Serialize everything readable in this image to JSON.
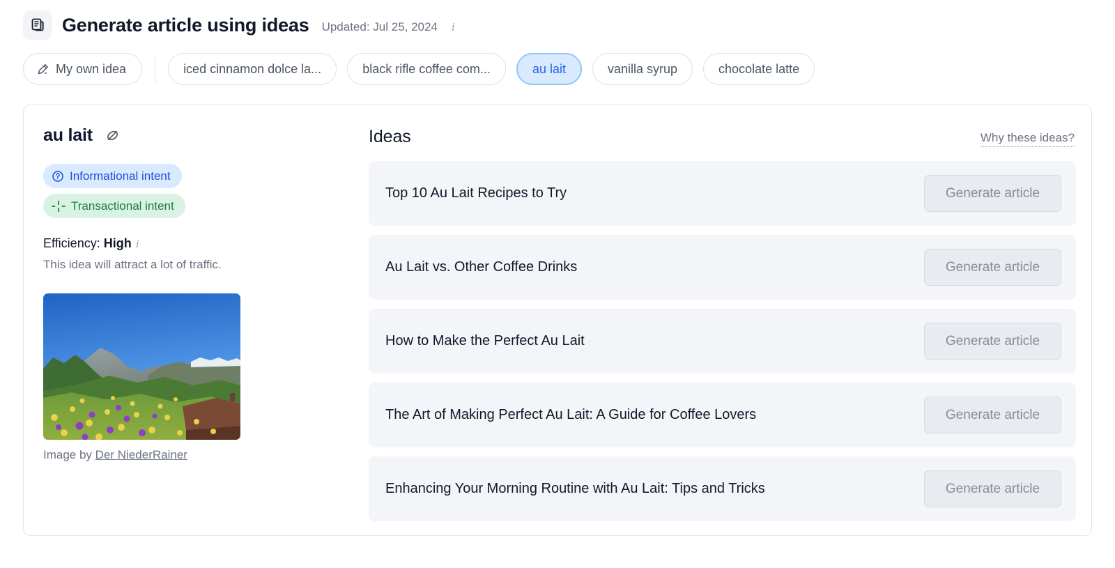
{
  "header": {
    "icon": "article-document-icon",
    "title": "Generate article using ideas",
    "updated": "Updated: Jul 25, 2024",
    "info_icon": "info-icon"
  },
  "chips": {
    "own_idea": {
      "label": "My own idea",
      "icon": "pencil-edit-icon"
    },
    "items": [
      {
        "label": "iced cinnamon dolce la...",
        "selected": false
      },
      {
        "label": "black rifle coffee com...",
        "selected": false
      },
      {
        "label": "au lait",
        "selected": true
      },
      {
        "label": "vanilla syrup",
        "selected": false
      },
      {
        "label": "chocolate latte",
        "selected": false
      }
    ]
  },
  "detail": {
    "keyword": "au lait",
    "hide_icon": "eye-off-icon",
    "badges": [
      {
        "label": "Informational intent",
        "icon": "question-circle-icon",
        "color": "#1d4ed8",
        "bg": "#daeafe"
      },
      {
        "label": "Transactional intent",
        "icon": "crosshair-dashed-icon",
        "color": "#15803d",
        "bg": "#d9f2e3"
      }
    ],
    "efficiency_label": "Efficiency:",
    "efficiency_value": "High",
    "efficiency_info_icon": "info-icon",
    "efficiency_description": "This idea will attract a lot of traffic.",
    "image_alt": "mountain-meadow-photo",
    "caption_prefix": "Image by",
    "caption_author": "Der NiederRainer"
  },
  "ideas": {
    "title": "Ideas",
    "why_link": "Why these ideas?",
    "button_label": "Generate article",
    "items": [
      {
        "title": "Top 10 Au Lait Recipes to Try"
      },
      {
        "title": "Au Lait vs. Other Coffee Drinks"
      },
      {
        "title": "How to Make the Perfect Au Lait"
      },
      {
        "title": "The Art of Making Perfect Au Lait: A Guide for Coffee Lovers"
      },
      {
        "title": "Enhancing Your Morning Routine with Au Lait: Tips and Tricks"
      }
    ]
  },
  "colors": {
    "accent_blue": "#2563eb",
    "chip_selected_bg": "#daeafe",
    "chip_selected_border": "#93c5fd",
    "badge_green": "#15803d",
    "row_bg": "#f3f5f9",
    "button_bg": "#e9ebf0"
  }
}
